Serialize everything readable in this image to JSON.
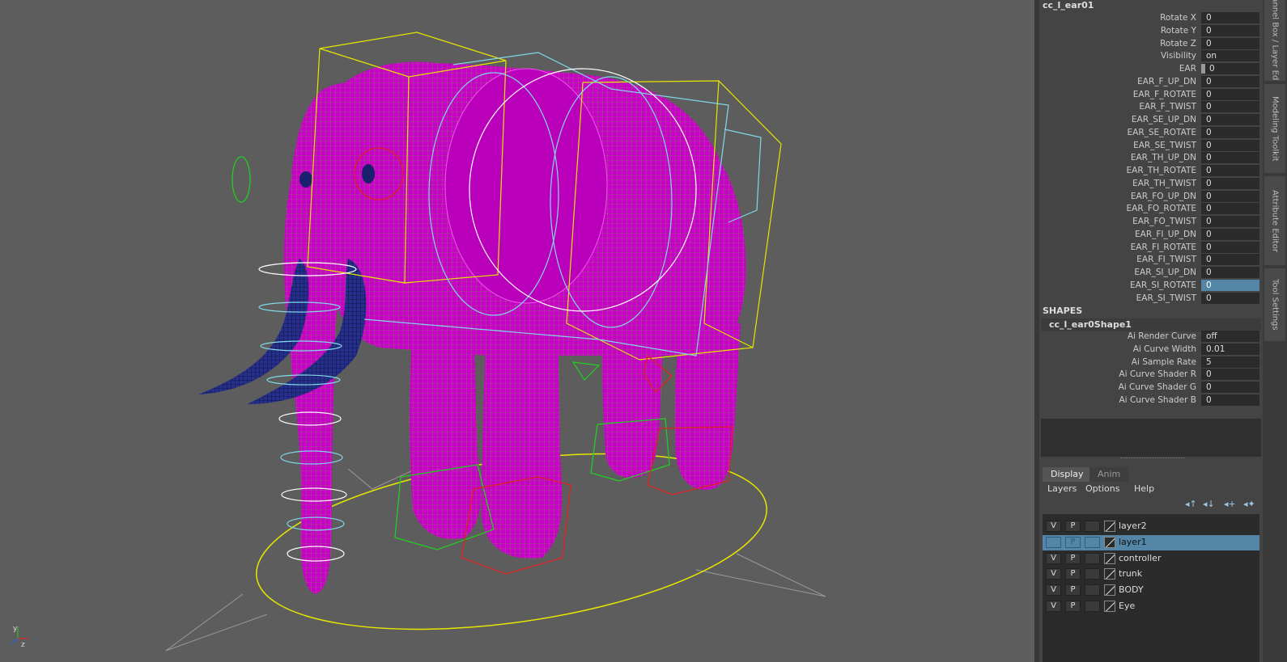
{
  "channel_box": {
    "node_name": "cc_l_ear01",
    "attributes": [
      {
        "label": "Rotate X",
        "value": "0"
      },
      {
        "label": "Rotate Y",
        "value": "0"
      },
      {
        "label": "Rotate Z",
        "value": "0"
      },
      {
        "label": "Visibility",
        "value": "on"
      },
      {
        "label": "EAR",
        "value": "0",
        "keyed": true
      },
      {
        "label": "EAR_F_UP_DN",
        "value": "0"
      },
      {
        "label": "EAR_F_ROTATE",
        "value": "0"
      },
      {
        "label": "EAR_F_TWIST",
        "value": "0"
      },
      {
        "label": "EAR_SE_UP_DN",
        "value": "0"
      },
      {
        "label": "EAR_SE_ROTATE",
        "value": "0"
      },
      {
        "label": "EAR_SE_TWIST",
        "value": "0"
      },
      {
        "label": "EAR_TH_UP_DN",
        "value": "0"
      },
      {
        "label": "EAR_TH_ROTATE",
        "value": "0"
      },
      {
        "label": "EAR_TH_TWIST",
        "value": "0"
      },
      {
        "label": "EAR_FO_UP_DN",
        "value": "0"
      },
      {
        "label": "EAR_FO_ROTATE",
        "value": "0"
      },
      {
        "label": "EAR_FO_TWIST",
        "value": "0"
      },
      {
        "label": "EAR_FI_UP_DN",
        "value": "0"
      },
      {
        "label": "EAR_FI_ROTATE",
        "value": "0"
      },
      {
        "label": "EAR_FI_TWIST",
        "value": "0"
      },
      {
        "label": "EAR_SI_UP_DN",
        "value": "0"
      },
      {
        "label": "EAR_SI_ROTATE",
        "value": "0",
        "selected": true
      },
      {
        "label": "EAR_SI_TWIST",
        "value": "0"
      }
    ],
    "shapes_header": "SHAPES",
    "shape_name": "cc_l_ear0Shape1",
    "shape_attributes": [
      {
        "label": "Ai Render Curve",
        "value": "off"
      },
      {
        "label": "Ai Curve Width",
        "value": "0.01"
      },
      {
        "label": "Ai Sample Rate",
        "value": "5"
      },
      {
        "label": "Ai Curve Shader R",
        "value": "0"
      },
      {
        "label": "Ai Curve Shader G",
        "value": "0"
      },
      {
        "label": "Ai Curve Shader B",
        "value": "0"
      }
    ]
  },
  "layer_editor": {
    "tabs": [
      "Display",
      "Anim"
    ],
    "menus": [
      "Layers",
      "Options",
      "Help"
    ],
    "layers": [
      {
        "v": "V",
        "p": "P",
        "name": "layer2"
      },
      {
        "v": "",
        "p": "P",
        "name": "layer1",
        "selected": true
      },
      {
        "v": "V",
        "p": "P",
        "name": "controller"
      },
      {
        "v": "V",
        "p": "P",
        "name": "trunk"
      },
      {
        "v": "V",
        "p": "P",
        "name": "BODY"
      },
      {
        "v": "V",
        "p": "P",
        "name": "Eye"
      }
    ]
  },
  "side_tabs": [
    "Channel Box / Layer Editor",
    "Modeling Toolkit",
    "Attribute Editor",
    "Tool Settings"
  ],
  "axis_labels": {
    "y": "y",
    "z": "z"
  },
  "colors": {
    "mesh": "#cc00cc",
    "tusk": "#1a1f6e",
    "selection": "#5285a6",
    "viewport": "#5d5d5d",
    "bbox_yellow": "#e6e600",
    "ctrl_cyan": "#80d8e8",
    "ctrl_green": "#22cc22",
    "ctrl_red": "#dd2222"
  }
}
